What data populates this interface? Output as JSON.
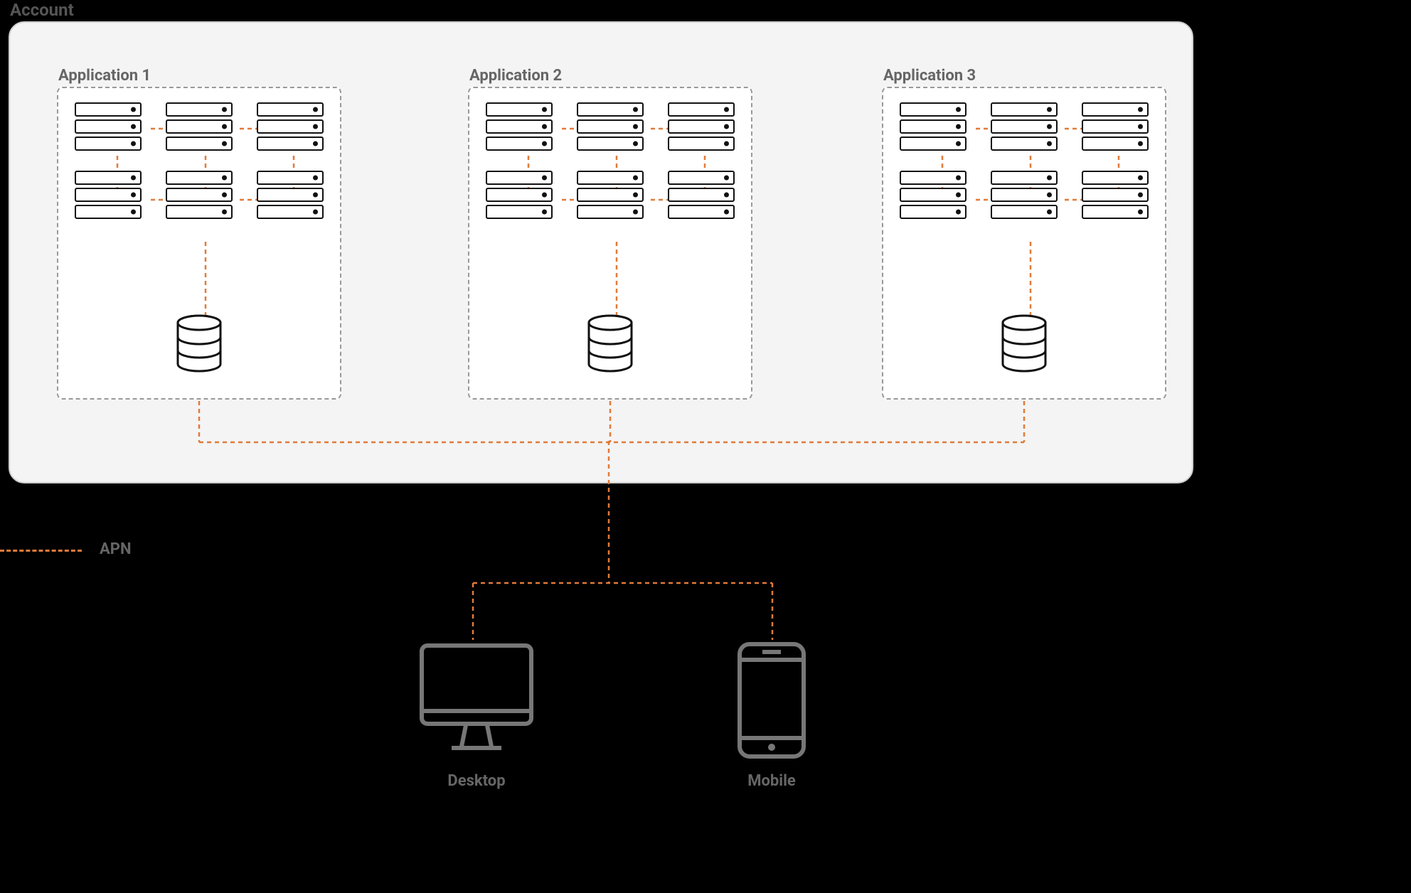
{
  "account": {
    "label": "Account"
  },
  "applications": [
    {
      "label": "Application 1"
    },
    {
      "label": "Application 2"
    },
    {
      "label": "Application 3"
    }
  ],
  "legend": {
    "label": "APN"
  },
  "devices": {
    "desktop": {
      "label": "Desktop"
    },
    "mobile": {
      "label": "Mobile"
    }
  },
  "colors": {
    "connector": "#e07b3a",
    "box_border": "#999",
    "account_bg": "#f4f4f4",
    "text": "#666"
  }
}
